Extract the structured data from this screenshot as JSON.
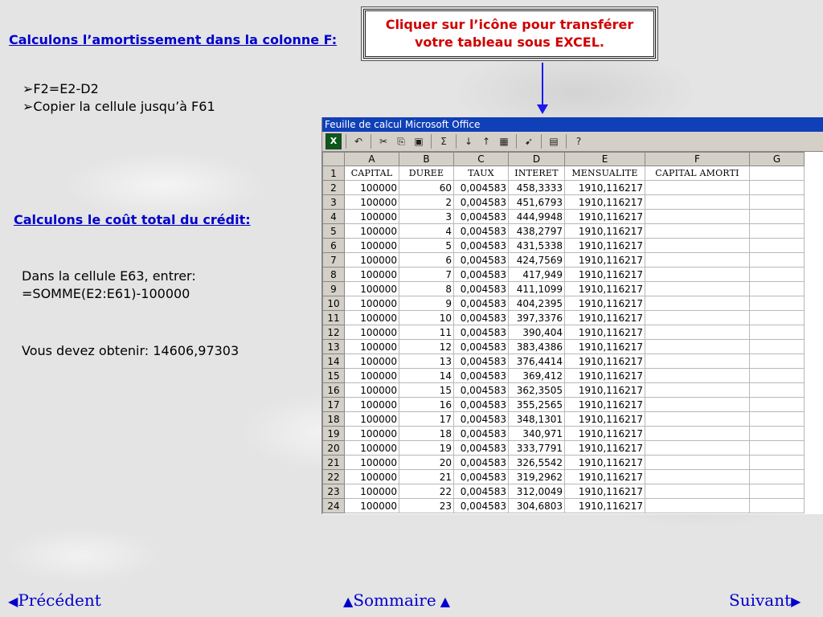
{
  "slide": {
    "heading1": "Calculons l’amortissement dans la colonne F:",
    "bullets": [
      "F2=E2-D2",
      "Copier la cellule jusqu’à F61"
    ],
    "heading2": "Calculons le coût total du crédit:",
    "instruction_line1": "Dans la cellule E63, entrer:",
    "instruction_line2": "=SOMME(E2:E61)-100000",
    "result": "Vous devez obtenir: 14606,97303",
    "callout_line1": "Cliquer sur l’icône pour transférer",
    "callout_line2": "votre tableau sous EXCEL."
  },
  "spreadsheet": {
    "title": "Feuille de calcul Microsoft Office",
    "toolbar_icons": [
      "excel-export-icon",
      "undo-icon",
      "cut-icon",
      "copy-icon",
      "paste-icon",
      "autosum-icon",
      "sort-ascending-icon",
      "sort-descending-icon",
      "autofilter-icon",
      "export-icon",
      "commands-options-icon",
      "help-icon"
    ],
    "columns": [
      "A",
      "B",
      "C",
      "D",
      "E",
      "F",
      "G"
    ],
    "header_row": [
      "CAPITAL",
      "DUREE",
      "TAUX",
      "INTERET",
      "MENSUALITE",
      "CAPITAL AMORTI",
      ""
    ],
    "rows": [
      [
        "2",
        "100000",
        "60",
        "0,004583",
        "458,3333",
        "1910,116217"
      ],
      [
        "3",
        "100000",
        "2",
        "0,004583",
        "451,6793",
        "1910,116217"
      ],
      [
        "4",
        "100000",
        "3",
        "0,004583",
        "444,9948",
        "1910,116217"
      ],
      [
        "5",
        "100000",
        "4",
        "0,004583",
        "438,2797",
        "1910,116217"
      ],
      [
        "6",
        "100000",
        "5",
        "0,004583",
        "431,5338",
        "1910,116217"
      ],
      [
        "7",
        "100000",
        "6",
        "0,004583",
        "424,7569",
        "1910,116217"
      ],
      [
        "8",
        "100000",
        "7",
        "0,004583",
        "417,949",
        "1910,116217"
      ],
      [
        "9",
        "100000",
        "8",
        "0,004583",
        "411,1099",
        "1910,116217"
      ],
      [
        "10",
        "100000",
        "9",
        "0,004583",
        "404,2395",
        "1910,116217"
      ],
      [
        "11",
        "100000",
        "10",
        "0,004583",
        "397,3376",
        "1910,116217"
      ],
      [
        "12",
        "100000",
        "11",
        "0,004583",
        "390,404",
        "1910,116217"
      ],
      [
        "13",
        "100000",
        "12",
        "0,004583",
        "383,4386",
        "1910,116217"
      ],
      [
        "14",
        "100000",
        "13",
        "0,004583",
        "376,4414",
        "1910,116217"
      ],
      [
        "15",
        "100000",
        "14",
        "0,004583",
        "369,412",
        "1910,116217"
      ],
      [
        "16",
        "100000",
        "15",
        "0,004583",
        "362,3505",
        "1910,116217"
      ],
      [
        "17",
        "100000",
        "16",
        "0,004583",
        "355,2565",
        "1910,116217"
      ],
      [
        "18",
        "100000",
        "17",
        "0,004583",
        "348,1301",
        "1910,116217"
      ],
      [
        "19",
        "100000",
        "18",
        "0,004583",
        "340,971",
        "1910,116217"
      ],
      [
        "20",
        "100000",
        "19",
        "0,004583",
        "333,7791",
        "1910,116217"
      ],
      [
        "21",
        "100000",
        "20",
        "0,004583",
        "326,5542",
        "1910,116217"
      ],
      [
        "22",
        "100000",
        "21",
        "0,004583",
        "319,2962",
        "1910,116217"
      ],
      [
        "23",
        "100000",
        "22",
        "0,004583",
        "312,0049",
        "1910,116217"
      ],
      [
        "24",
        "100000",
        "23",
        "0,004583",
        "304,6803",
        "1910,116217"
      ]
    ]
  },
  "nav": {
    "prev": "Précédent",
    "home": "Sommaire",
    "next": "Suivant"
  }
}
